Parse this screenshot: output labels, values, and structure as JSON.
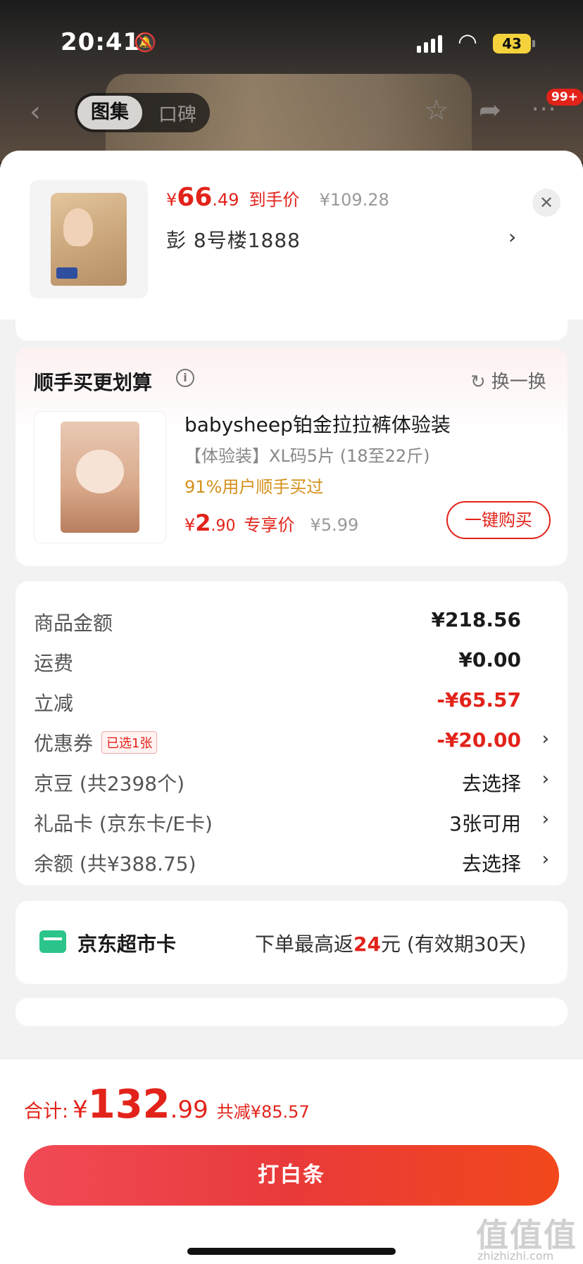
{
  "status_bar": {
    "time": "20:41",
    "battery": "43"
  },
  "nav": {
    "tab_gallery": "图集",
    "tab_reviews": "口碑",
    "badge": "99+"
  },
  "header": {
    "currency": "¥",
    "price_int": "66",
    "price_dec": ".49",
    "price_label": "到手价",
    "original_price": "¥109.28",
    "address": "彭  8号楼1888"
  },
  "upsell": {
    "title": "顺手买更划算",
    "swap_label": "换一换",
    "product_name": "babysheep铂金拉拉裤体验装",
    "spec": "【体验装】XL码5片 (18至22斤)",
    "social_proof": "91%用户顺手买过",
    "currency": "¥",
    "price_int": "2",
    "price_dec": ".90",
    "price_label": "专享价",
    "original_price": "¥5.99",
    "buy_button": "一键购买"
  },
  "summary": {
    "rows": [
      {
        "label": "商品金额",
        "value": "¥218.56"
      },
      {
        "label": "运费",
        "value": "¥0.00"
      },
      {
        "label": "立减",
        "value": "-¥65.57"
      },
      {
        "label": "优惠券",
        "tag": "已选1张",
        "value": "-¥20.00"
      },
      {
        "label": "京豆 (共2398个)",
        "value": "去选择"
      },
      {
        "label": "礼品卡 (京东卡/E卡)",
        "value": "3张可用"
      },
      {
        "label": "余额 (共¥388.75)",
        "value": "去选择"
      }
    ]
  },
  "market_card": {
    "title": "京东超市卡",
    "desc_prefix": "下单最高返",
    "desc_amount": "24",
    "desc_suffix": "元 (有效期30天)"
  },
  "footer": {
    "total_label": "合计:",
    "currency": "¥",
    "total_int": "132",
    "total_dec": ".99",
    "saving": "共减¥85.57",
    "pay_button": "打白条"
  },
  "watermark": {
    "logo": "值值值",
    "site": "zhizhizhi.com"
  },
  "colors": {
    "accent": "#e2231a",
    "card_green": "#2bc48a",
    "social_proof": "#d4901a"
  }
}
